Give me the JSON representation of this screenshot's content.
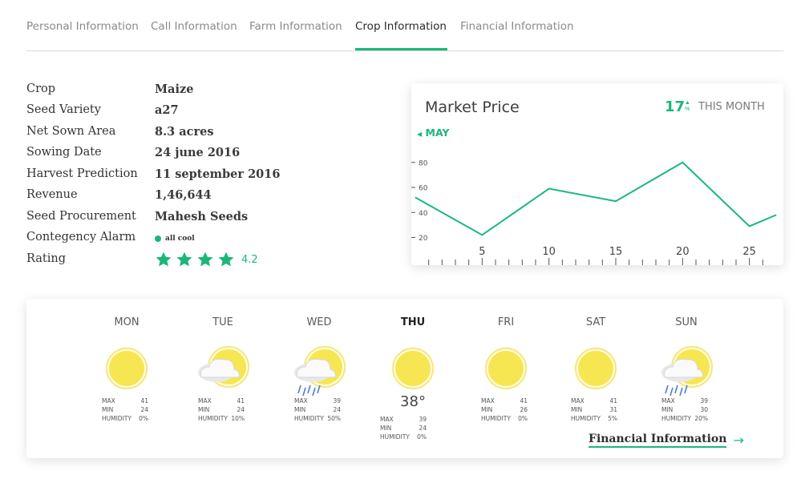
{
  "tabs": [
    {
      "label": "Personal Information",
      "active": false
    },
    {
      "label": "Call Information",
      "active": false
    },
    {
      "label": "Farm Information",
      "active": false
    },
    {
      "label": "Crop Information",
      "active": true
    },
    {
      "label": "Financial Information",
      "active": false
    }
  ],
  "crop_info": {
    "rows": [
      {
        "label": "Crop",
        "value": "Maize"
      },
      {
        "label": "Seed Variety",
        "value": "a27"
      },
      {
        "label": "Net Sown Area",
        "value": "8.3 acres"
      },
      {
        "label": "Sowing Date",
        "value": "24 june 2016"
      },
      {
        "label": "Harvest Prediction",
        "value": "11 september 2016"
      },
      {
        "label": "Revenue",
        "value": "1,46,644"
      },
      {
        "label": "Seed Procurement",
        "value": "Mahesh Seeds"
      }
    ],
    "alarm": {
      "label": "Contegency Alarm",
      "status": "all cool"
    },
    "rating": {
      "label": "Rating",
      "value": "4.2",
      "stars": 4
    }
  },
  "market_price": {
    "title": "Market Price",
    "change_value": "17",
    "change_unit": "%",
    "period": "THIS MONTH",
    "month": "MAY",
    "accent": "#1ab77a"
  },
  "chart_data": {
    "type": "line",
    "x": [
      0,
      5,
      10,
      15,
      20,
      25,
      27
    ],
    "values": [
      52,
      22,
      59,
      49,
      80,
      29,
      38
    ],
    "x_ticks": [
      "5",
      "10",
      "15",
      "20",
      "25"
    ],
    "y_ticks": [
      "20",
      "40",
      "60",
      "80"
    ],
    "xlim": [
      0,
      27
    ],
    "ylim": [
      12,
      92
    ],
    "grid": false
  },
  "weather": {
    "labels": {
      "max": "MAX",
      "min": "MIN",
      "humidity": "HUMIDITY"
    },
    "days": [
      {
        "day": "MON",
        "icon": "sun-icon",
        "max": "41",
        "min": "24",
        "humidity": "0%"
      },
      {
        "day": "TUE",
        "icon": "cloud-sun-icon",
        "max": "41",
        "min": "24",
        "humidity": "10%"
      },
      {
        "day": "WED",
        "icon": "rain-sun-icon",
        "max": "39",
        "min": "24",
        "humidity": "50%"
      },
      {
        "day": "THU",
        "icon": "sun-icon",
        "today": true,
        "temp": "38°",
        "max": "39",
        "min": "24",
        "humidity": "0%"
      },
      {
        "day": "FRI",
        "icon": "sun-icon",
        "max": "41",
        "min": "26",
        "humidity": "0%"
      },
      {
        "day": "SAT",
        "icon": "sun-icon",
        "max": "41",
        "min": "31",
        "humidity": "5%"
      },
      {
        "day": "SUN",
        "icon": "rain-sun-icon",
        "max": "39",
        "min": "30",
        "humidity": "20%"
      }
    ],
    "link_label": "Financial Information",
    "link_icon": "arrow-right-icon"
  }
}
